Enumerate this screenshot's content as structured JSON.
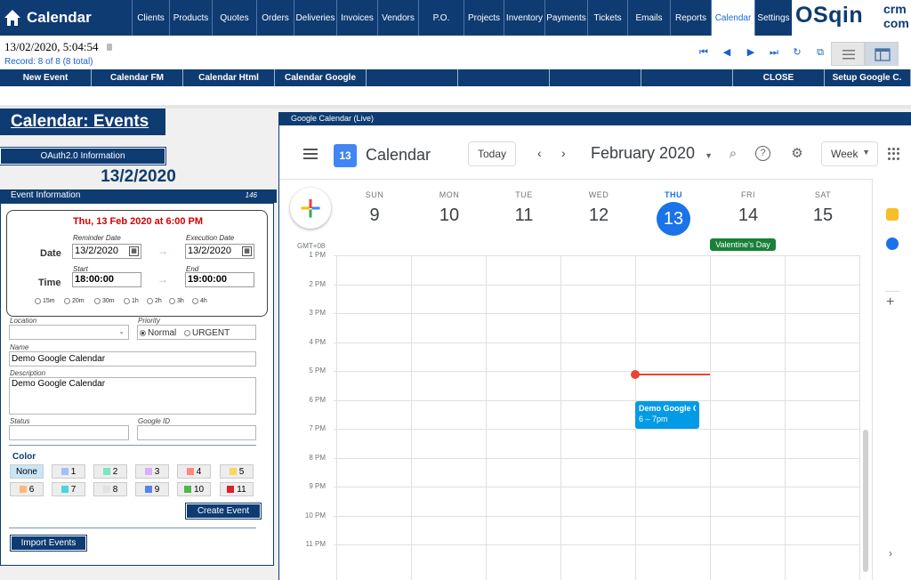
{
  "brand": {
    "title": "Calendar"
  },
  "nav": [
    "Clients",
    "Products",
    "Quotes",
    "Orders",
    "Deliveries",
    "Invoices",
    "Vendors",
    "P.O.",
    "Projects",
    "Inventory",
    "Payments",
    "Tickets",
    "Emails",
    "Reports",
    "Calendar",
    "Settings"
  ],
  "nav_active": "Calendar",
  "logo": {
    "main": "OSqin",
    "top": "crm",
    "bottom": "com"
  },
  "info": {
    "datetime": "13/02/2020, 5:04:54",
    "record": "Record:  8 of 8 (8 total)"
  },
  "actions": [
    "New Event",
    "Calendar FM",
    "Calendar Html",
    "Calendar Google",
    "",
    "",
    "",
    "",
    "CLOSE",
    "Setup Google C."
  ],
  "left": {
    "title": "Calendar: Events",
    "oauth": "OAuth2.0 Information",
    "big_date": "13/2/2020",
    "section": "Event Information",
    "section_num": "146",
    "summary": "Thu, 13 Feb 2020  at 6:00 PM",
    "date_label": "Date",
    "time_label": "Time",
    "reminder_date_label": "Reminder Date",
    "execution_date_label": "Execution Date",
    "start_label": "Start",
    "end_label": "End",
    "reminder_date": "13/2/2020",
    "execution_date": "13/2/2020",
    "start": "18:00:00",
    "end": "19:00:00",
    "durations": [
      "15m",
      "20m",
      "30m",
      "1h",
      "2h",
      "3h",
      "4h"
    ],
    "location_label": "Location",
    "location": "",
    "priority_label": "Priority",
    "priority_normal": "Normal",
    "priority_urgent": "URGENT",
    "name_label": "Name",
    "name": "Demo Google Calendar",
    "description_label": "Description",
    "description": "Demo Google Calendar",
    "status_label": "Status",
    "status": "",
    "google_id_label": "Google ID",
    "google_id": "",
    "color_label": "Color",
    "colors": [
      {
        "label": "None",
        "swatch": ""
      },
      {
        "label": "1",
        "swatch": "#a4bdfc"
      },
      {
        "label": "2",
        "swatch": "#7ae7bf"
      },
      {
        "label": "3",
        "swatch": "#dbadff"
      },
      {
        "label": "4",
        "swatch": "#ff887c"
      },
      {
        "label": "5",
        "swatch": "#fbd75b"
      },
      {
        "label": "6",
        "swatch": "#ffb878"
      },
      {
        "label": "7",
        "swatch": "#46d6db"
      },
      {
        "label": "8",
        "swatch": "#e1e1e1"
      },
      {
        "label": "9",
        "swatch": "#5484ed"
      },
      {
        "label": "10",
        "swatch": "#51b749"
      },
      {
        "label": "11",
        "swatch": "#dc2127"
      }
    ],
    "create_button": "Create Event",
    "import_button": "Import Events"
  },
  "gcal": {
    "frame_title": "Google Calendar (Live)",
    "app_name": "Calendar",
    "app_icon_day": "13",
    "today_button": "Today",
    "month": "February 2020",
    "view": "Week",
    "timezone": "GMT+08",
    "days": [
      {
        "name": "SUN",
        "num": "9"
      },
      {
        "name": "MON",
        "num": "10"
      },
      {
        "name": "TUE",
        "num": "11"
      },
      {
        "name": "WED",
        "num": "12"
      },
      {
        "name": "THU",
        "num": "13"
      },
      {
        "name": "FRI",
        "num": "14"
      },
      {
        "name": "SAT",
        "num": "15"
      }
    ],
    "current_day": "13",
    "all_day_event": "Valentine's Day",
    "hours": [
      "1 PM",
      "2 PM",
      "3 PM",
      "4 PM",
      "5 PM",
      "6 PM",
      "7 PM",
      "8 PM",
      "9 PM",
      "10 PM",
      "11 PM"
    ],
    "event": {
      "title": "Demo Google C",
      "time": "6 – 7pm"
    },
    "colors": {
      "accent": "#1a73e8",
      "event": "#039be5",
      "now": "#ea4335",
      "holiday": "#188038"
    }
  },
  "colors": {
    "navy": "#0e3b72",
    "summary_red": "#d40000",
    "link_blue": "#1a5fcf"
  }
}
